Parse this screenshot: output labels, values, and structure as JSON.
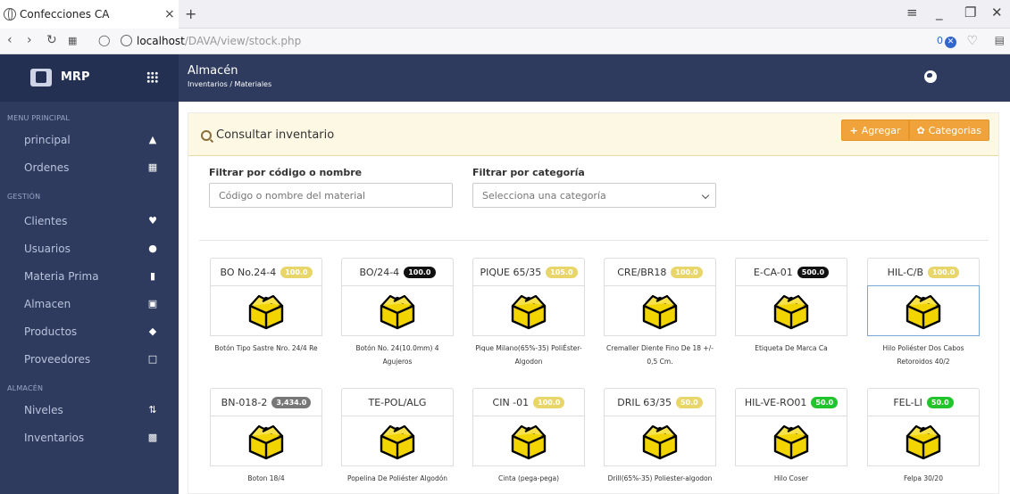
{
  "browser": {
    "tab_title": "Confecciones CA",
    "tab_close": "×",
    "tab_new": "+",
    "url_host": "localhost",
    "url_path": "/DAVA/view/stock.php",
    "zoom": "0"
  },
  "header": {
    "brand": "MRP",
    "title": "Almacén",
    "breadcrumb": "Inventarios / Materiales"
  },
  "sidebar": {
    "sections": [
      "MENU PRINCIPAL",
      "GESTIÓN",
      "ALMACÉN"
    ],
    "items": [
      {
        "label": "principal",
        "icon": "home-icon"
      },
      {
        "label": "Ordenes",
        "icon": "list-icon"
      },
      {
        "label": "Clientes",
        "icon": "heart-icon"
      },
      {
        "label": "Usuarios",
        "icon": "user-icon"
      },
      {
        "label": "Materia Prima",
        "icon": "file-icon"
      },
      {
        "label": "Almacen",
        "icon": "inbox-icon"
      },
      {
        "label": "Productos",
        "icon": "tag-icon"
      },
      {
        "label": "Proveedores",
        "icon": "phone-icon"
      },
      {
        "label": "Niveles",
        "icon": "sort-icon"
      },
      {
        "label": "Inventarios",
        "icon": "briefcase-icon"
      }
    ]
  },
  "panel": {
    "title": "Consultar inventario",
    "add_label": "Agregar",
    "categories_label": "Categorias"
  },
  "filters": {
    "code_label": "Filtrar por código o nombre",
    "code_placeholder": "Código o nombre del material",
    "category_label": "Filtrar por categoría",
    "category_selected": "Selecciona una categoría"
  },
  "products": [
    {
      "code": "BO No.24-4",
      "qty": "100.0",
      "badge": "yellow",
      "name": "Botón Tipo Sastre Nro. 24/4 Re"
    },
    {
      "code": "BO/24-4",
      "qty": "100.0",
      "badge": "black",
      "name": "Botón No. 24(10.0mm) 4 Agujeros"
    },
    {
      "code": "PIQUE 65/35",
      "qty": "105.0",
      "badge": "yellow",
      "name": "Pique Milano(65%-35) PoliÉster-Algodon"
    },
    {
      "code": "CRE/BR18",
      "qty": "100.0",
      "badge": "yellow",
      "name": "Cremaller Diente Fino De 18 +/- 0,5 Cm."
    },
    {
      "code": "E-CA-01",
      "qty": "500.0",
      "badge": "black",
      "name": "Etiqueta De Marca Ca"
    },
    {
      "code": "HIL-C/B",
      "qty": "100.0",
      "badge": "yellow",
      "name": "Hilo Poliéster Dos Cabos Retoroidos 40/2"
    },
    {
      "code": "BN-018-2",
      "qty": "3,434.0",
      "badge": "gray",
      "name": "Boton 18/4"
    },
    {
      "code": "TE-POL/ALG",
      "qty": "",
      "badge": "",
      "name": "Popelina De Poliéster Algodón"
    },
    {
      "code": "CIN -01",
      "qty": "100.0",
      "badge": "yellow",
      "name": "Cinta (pega-pega)"
    },
    {
      "code": "DRIL 63/35",
      "qty": "50.0",
      "badge": "yellow",
      "name": "Drill(65%-35) Poliester-algodon"
    },
    {
      "code": "HIL-VE-RO01",
      "qty": "50.0",
      "badge": "green",
      "name": "Hilo Coser"
    },
    {
      "code": "FEL-LI",
      "qty": "50.0",
      "badge": "green",
      "name": "Felpa 30/20"
    }
  ],
  "colors": {
    "sidebar_bg": "#2e3b5e",
    "accent_orange": "#f0a33a",
    "panel_header": "#fcf8e3",
    "badge_yellow": "#e8d66a",
    "badge_green": "#22c42c"
  }
}
